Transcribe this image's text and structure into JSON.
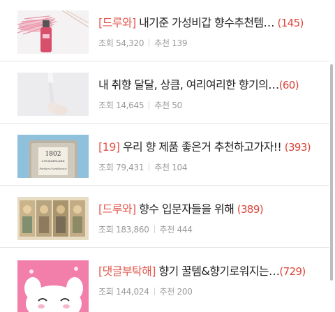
{
  "posts": [
    {
      "tag": "[드루와]",
      "title": " 내기준 가성비갑 향수추천템…",
      "comment_count": "(145)",
      "views_label": "조회",
      "views": "54,320",
      "recommend_label": "추천",
      "recommends": "139",
      "thumb_icon": "pink-perfume-bottle-image"
    },
    {
      "tag": "",
      "title": "내 취향 달달, 상큼, 여리여리한 향기의…",
      "comment_count": "(60)",
      "views_label": "조회",
      "views": "14,645",
      "recommend_label": "추천",
      "recommends": "50",
      "thumb_icon": "perfume-stick-image"
    },
    {
      "tag": "[19]",
      "title": " 우리 향 제품 좋은거 추천하고가자!!",
      "comment_count": "(393)",
      "views_label": "조회",
      "views": "79,431",
      "recommend_label": "추천",
      "recommends": "104",
      "thumb_icon": "vintage-perfume-bottle-image",
      "bottle_text": [
        "1802",
        "L'ECHATELARD",
        "Parfum d'ambiance"
      ]
    },
    {
      "tag": "[드루와]",
      "title": " 향수 입문자들을 위해",
      "comment_count": "(389)",
      "views_label": "조회",
      "views": "183,860",
      "recommend_label": "추천",
      "recommends": "444",
      "thumb_icon": "art-nouveau-poster-image"
    },
    {
      "tag": "[댓글부탁해]",
      "title": " 향기 꿀템&향기로워지는…",
      "comment_count": "(729)",
      "views_label": "조회",
      "views": "144,024",
      "recommend_label": "추천",
      "recommends": "200",
      "thumb_icon": "pink-character-image"
    }
  ],
  "colors": {
    "tag": "#e2574c",
    "count": "#d9453a",
    "meta": "#9a9a9a"
  }
}
